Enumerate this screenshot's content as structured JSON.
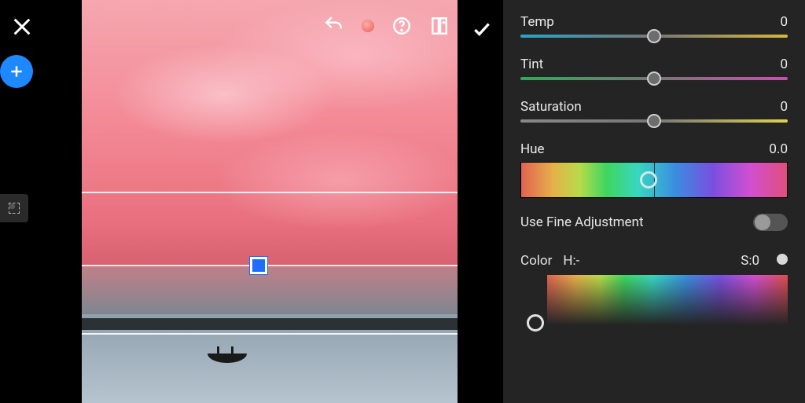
{
  "toolbar": {
    "close": "close",
    "add": "add",
    "undo": "undo",
    "help": "help",
    "copy_edits": "copy-edits",
    "recording_dot": "recording",
    "apply": "apply",
    "grid_tool": "selection-mask"
  },
  "sliders": {
    "temp": {
      "label": "Temp",
      "value": 0
    },
    "tint": {
      "label": "Tint",
      "value": 0
    },
    "saturation": {
      "label": "Saturation",
      "value": 0
    },
    "hue": {
      "label": "Hue",
      "value": "0.0"
    }
  },
  "fine_adjustment": {
    "label": "Use Fine Adjustment",
    "enabled": false
  },
  "color_picker": {
    "label": "Color",
    "h_label": "H:-",
    "s_label": "S:0"
  }
}
